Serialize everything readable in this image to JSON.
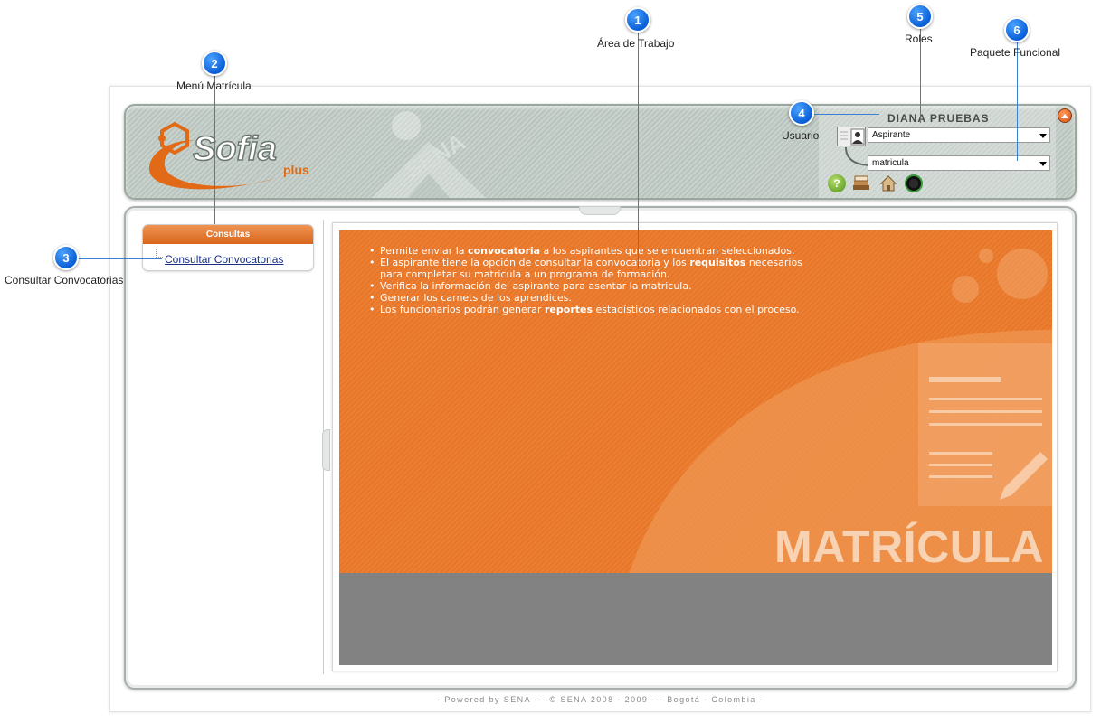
{
  "annotations": [
    {
      "number": "1",
      "label": "Área de Trabajo"
    },
    {
      "number": "2",
      "label": "Menú Matrícula"
    },
    {
      "number": "3",
      "label": "Consultar Convocatorias"
    },
    {
      "number": "4",
      "label": "Usuario"
    },
    {
      "number": "5",
      "label": "Roles"
    },
    {
      "number": "6",
      "label": "Paquete Funcional"
    }
  ],
  "header": {
    "logo_text": "Sofia",
    "logo_sub": "plus",
    "watermark": "SENA",
    "user_name": "DIANA PRUEBAS",
    "role_select": {
      "value": "Aspirante"
    },
    "package_select": {
      "value": "matricula"
    },
    "toolbar_icons": [
      "help-icon",
      "books-icon",
      "home-icon",
      "exit-icon"
    ]
  },
  "menu": {
    "header": "Consultas",
    "items": [
      {
        "label": "Consultar Convocatorias"
      }
    ]
  },
  "workspace": {
    "bullets": [
      {
        "before": "Permite enviar la ",
        "bold": "convocatoria",
        "after": " a los aspirantes que se encuentran seleccionados."
      },
      {
        "before": "El aspirante tiene la opción de consultar la convocatoria y los ",
        "bold": "requisitos",
        "after": " necesarios para completar su matricula a un programa de formación."
      },
      {
        "before": "Verifica la información del aspirante para asentar la matricula.",
        "bold": "",
        "after": ""
      },
      {
        "before": "Generar los carnets de los aprendices.",
        "bold": "",
        "after": ""
      },
      {
        "before": "Los funcionarios podrán generar ",
        "bold": "reportes",
        "after": " estadísticos relacionados con el proceso."
      }
    ],
    "title": "MATRÍCULA"
  },
  "footer": "- Powered by SENA --- © SENA 2008 - 2009 --- Bogotá - Colombia -",
  "colors": {
    "accent": "#e6772a",
    "callout": "#0a5fd6",
    "link": "#1a2f80"
  }
}
